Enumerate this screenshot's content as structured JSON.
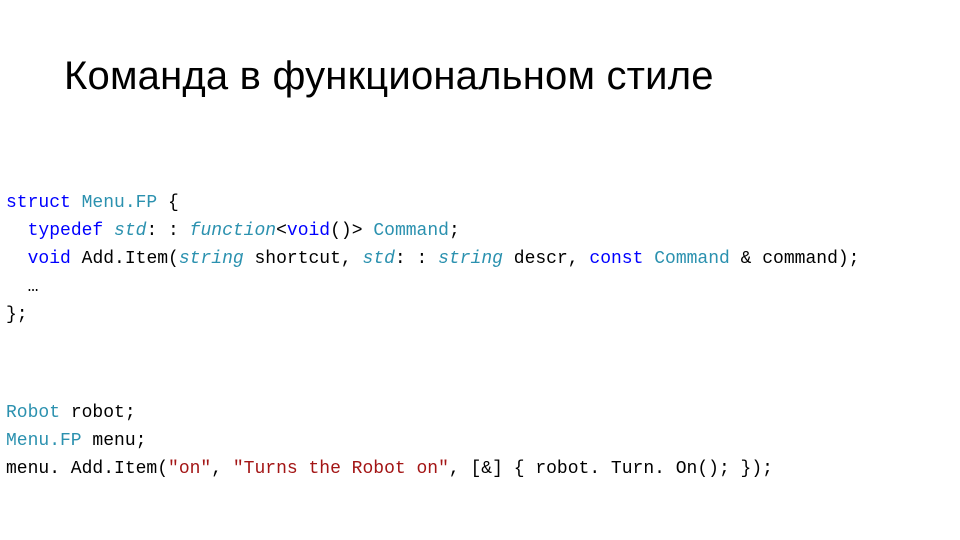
{
  "title": "Команда в функциональном стиле",
  "code1": {
    "l1": {
      "kw1": "struct",
      "sp1": " ",
      "t1": "Menu.FP",
      "rest": " {"
    },
    "l2": {
      "indent": "  ",
      "kw1": "typedef",
      "sp1": " ",
      "it1": "std",
      "p1": ": : ",
      "it2": "function",
      "p2": "<",
      "kw2": "void",
      "p3": "()> ",
      "t1": "Command",
      "p4": ";"
    },
    "l3": {
      "indent": "  ",
      "kw1": "void",
      "sp1": " ",
      "m1": "Add.Item(",
      "it1": "string",
      "sp2": " ",
      "a1": "shortcut, ",
      "it2": "std",
      "p1": ": : ",
      "it3": "string",
      "sp3": " ",
      "a2": "descr, ",
      "kw2": "const",
      "sp4": " ",
      "t1": "Command",
      "sp5": " ",
      "a3": "& command);"
    },
    "l4": {
      "indent": "  ",
      "txt": "…"
    },
    "l5": {
      "txt": "};"
    }
  },
  "code2": {
    "l1": {
      "t1": "Robot",
      "rest": " robot;"
    },
    "l2": {
      "t1": "Menu.FP",
      "rest": " menu;"
    },
    "l3": {
      "p1": "menu. Add.Item(",
      "s1": "\"on\"",
      "p2": ", ",
      "s2": "\"Turns the Robot on\"",
      "p3": ", [&] { robot. Turn. On(); });"
    }
  }
}
